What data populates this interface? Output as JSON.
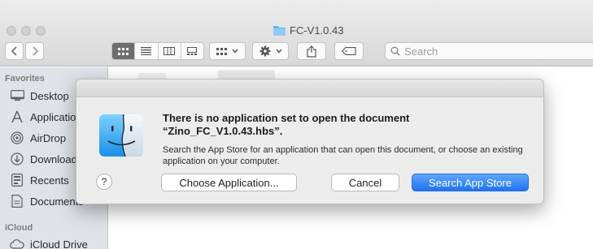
{
  "window": {
    "title": "FC-V1.0.43"
  },
  "toolbar": {
    "search_placeholder": "Search",
    "icons": [
      "chevron-left-icon",
      "chevron-right-icon",
      "icon-view-icon",
      "list-view-icon",
      "column-view-icon",
      "gallery-view-icon",
      "group-icon",
      "gear-icon",
      "share-icon",
      "tag-icon",
      "search-icon"
    ]
  },
  "sidebar": {
    "favorites_header": "Favorites",
    "items": [
      {
        "label": "Desktop",
        "icon": "desktop-icon"
      },
      {
        "label": "Applications",
        "icon": "applications-icon"
      },
      {
        "label": "AirDrop",
        "icon": "airdrop-icon"
      },
      {
        "label": "Downloads",
        "icon": "downloads-icon"
      },
      {
        "label": "Recents",
        "icon": "recents-icon"
      },
      {
        "label": "Documents",
        "icon": "documents-icon"
      }
    ],
    "icloud_header": "iCloud",
    "icloud_items": [
      {
        "label": "iCloud Drive",
        "icon": "icloud-icon"
      }
    ]
  },
  "dialog": {
    "title_line1": "There is no application set to open the document",
    "title_line2": "“Zino_FC_V1.0.43.hbs”.",
    "body": "Search the App Store for an application that can open this document, or choose an existing application on your computer.",
    "help_label": "?",
    "choose_label": "Choose Application...",
    "cancel_label": "Cancel",
    "search_store_label": "Search App Store"
  },
  "colors": {
    "accent": "#1f73f0",
    "sidebar_bg": "#dfe3e8",
    "dialog_bg": "#ececec"
  }
}
